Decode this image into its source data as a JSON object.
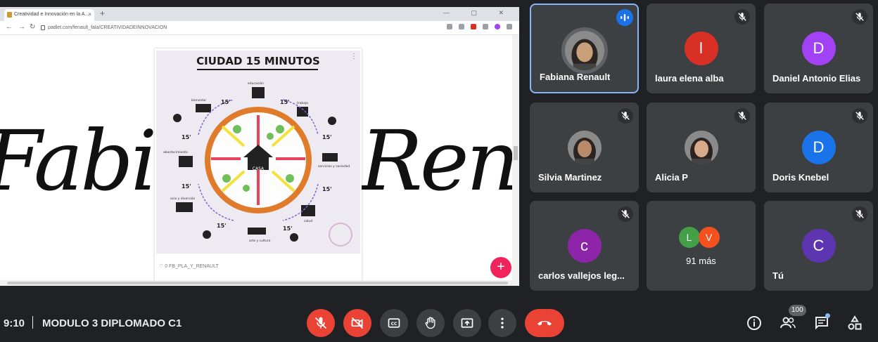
{
  "browser": {
    "tab_title": "Creatividad e Innovación en la A...",
    "tab_close": "×",
    "new_tab": "+",
    "url": "padlet.com/fenault_fala/CREATIVIDADEINNOVACION"
  },
  "presentation": {
    "script_left": "Fabian",
    "script_right": "Renau",
    "poster_title": "CIUDAD 15 MINUTOS",
    "poster_center_label": "CASA",
    "poster_minutes": "15'",
    "poster_labels": [
      "educación",
      "trabajo",
      "servicios y sociedad",
      "salud",
      "arte y cultura",
      "ocio y diversión",
      "abastecimiento",
      "bienestar"
    ],
    "card_footer": "♡ 0     FB_PLA_Y_RENAULT",
    "card_menu": "⋮",
    "add_button": "+"
  },
  "participants": [
    {
      "name": "Fabiana Renault",
      "initial": "",
      "color": "#5f6368",
      "state": "speaking",
      "photo": true
    },
    {
      "name": "laura elena alba",
      "initial": "l",
      "color": "#d93025",
      "state": "muted",
      "photo": false
    },
    {
      "name": "Daniel Antonio Elias",
      "initial": "D",
      "color": "#a142f4",
      "state": "muted",
      "photo": false
    },
    {
      "name": "Silvia Martinez",
      "initial": "",
      "color": "#5f6368",
      "state": "muted",
      "photo": true
    },
    {
      "name": "Alicia P",
      "initial": "",
      "color": "#5f6368",
      "state": "muted",
      "photo": true
    },
    {
      "name": "Doris Knebel",
      "initial": "D",
      "color": "#1a73e8",
      "state": "muted",
      "photo": false
    },
    {
      "name": "carlos vallejos leg...",
      "initial": "c",
      "color": "#8e24aa",
      "state": "muted",
      "photo": false
    },
    {
      "name": "",
      "initial": "",
      "color": "",
      "state": "more",
      "photo": false
    },
    {
      "name": "Tú",
      "initial": "C",
      "color": "#5e35b1",
      "state": "muted",
      "photo": false
    }
  ],
  "more_tile": {
    "avatars": [
      {
        "initial": "L",
        "color": "#43a047"
      },
      {
        "initial": "V",
        "color": "#f4511e"
      }
    ],
    "label": "91 más"
  },
  "meeting": {
    "time": "9:10",
    "title": "MODULO 3 DIPLOMADO C1",
    "people_count": "100"
  },
  "controls": [
    {
      "name": "microphone-off-button",
      "icon": "mic-off-icon",
      "state": "off"
    },
    {
      "name": "camera-off-button",
      "icon": "camera-off-icon",
      "state": "off"
    },
    {
      "name": "captions-button",
      "icon": "captions-icon",
      "state": "neutral"
    },
    {
      "name": "raise-hand-button",
      "icon": "hand-icon",
      "state": "neutral"
    },
    {
      "name": "present-button",
      "icon": "present-icon",
      "state": "neutral"
    },
    {
      "name": "more-options-button",
      "icon": "more-vert-icon",
      "state": "neutral"
    },
    {
      "name": "leave-call-button",
      "icon": "end-call-icon",
      "state": "danger"
    }
  ],
  "colors": {
    "background": "#202124",
    "tile": "#3c4043",
    "danger": "#ea4335",
    "active_border": "#8ab4f8",
    "speaking": "#1a73e8"
  }
}
